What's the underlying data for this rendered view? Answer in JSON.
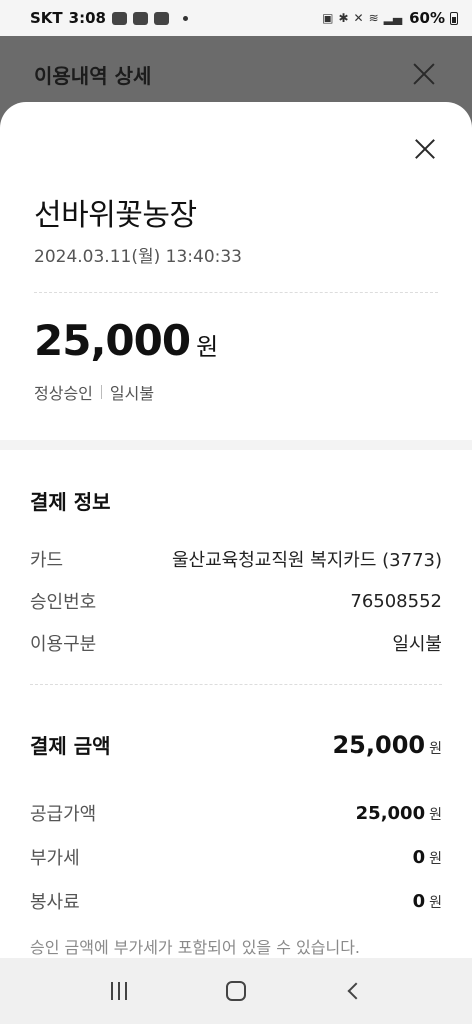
{
  "status_bar": {
    "carrier": "SKT",
    "time": "3:08",
    "battery": "60%"
  },
  "header": {
    "title": "이용내역 상세"
  },
  "detail": {
    "merchant": "선바위꽃농장",
    "datetime": "2024.03.11(월) 13:40:33",
    "amount": "25,000",
    "amount_unit": "원",
    "status": "정상승인",
    "installment": "일시불"
  },
  "payment_info": {
    "title": "결제 정보",
    "rows": [
      {
        "label": "카드",
        "value": "울산교육청교직원 복지카드 (3773)"
      },
      {
        "label": "승인번호",
        "value": "76508552"
      },
      {
        "label": "이용구분",
        "value": "일시불"
      }
    ]
  },
  "payment_amount": {
    "title": "결제 금액",
    "total": "25,000",
    "unit": "원",
    "rows": [
      {
        "label": "공급가액",
        "value": "25,000",
        "unit": "원"
      },
      {
        "label": "부가세",
        "value": "0",
        "unit": "원"
      },
      {
        "label": "봉사료",
        "value": "0",
        "unit": "원"
      }
    ],
    "notice": "승인 금액에 부가세가 포함되어 있을 수 있습니다."
  }
}
